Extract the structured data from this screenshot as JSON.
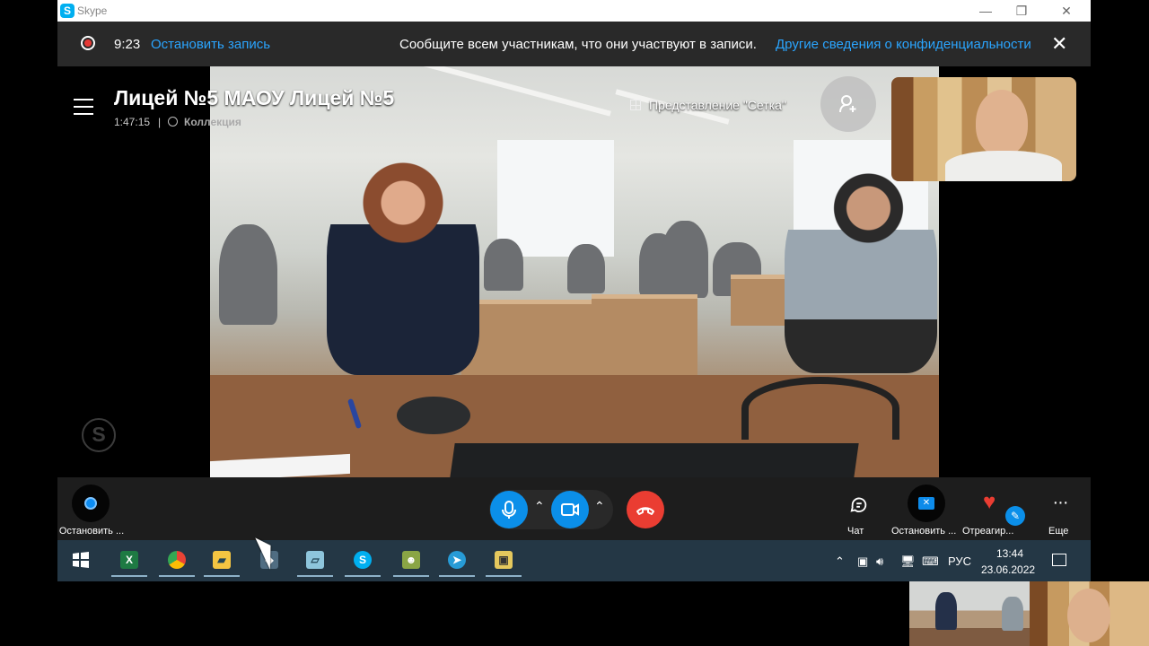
{
  "window": {
    "app_title": "Skype",
    "controls": [
      "—",
      "❐",
      "✕"
    ]
  },
  "recording": {
    "time": "9:23",
    "stop_label": "Остановить запись",
    "notice": "Сообщите всем участникам, что они участвуют в записи.",
    "privacy_link": "Другие сведения о конфиденциальности"
  },
  "meeting": {
    "title": "Лицей №5 МАОУ Лицей №5",
    "duration": "1:47:15",
    "separator": "|",
    "collection": "Коллекция",
    "grid_view": "Представление \"Сетка\""
  },
  "controls": {
    "stop_recording": "Остановить ...",
    "chat": "Чат",
    "share": "Остановить ...",
    "react": "Отреагир...",
    "more": "Еще"
  },
  "taskbar": {
    "language": "РУС",
    "time": "13:44",
    "date": "23.06.2022",
    "apps": [
      "start-icon",
      "excel-icon",
      "chrome-icon",
      "file-explorer-icon",
      "app-icon",
      "notes-icon",
      "skype-icon",
      "game-icon",
      "telegram-icon",
      "photos-icon"
    ]
  },
  "colors": {
    "accent_blue": "#0b8fe9",
    "link_blue": "#2aa5ff",
    "hangup_red": "#ea3d32",
    "taskbar": "#243745"
  }
}
